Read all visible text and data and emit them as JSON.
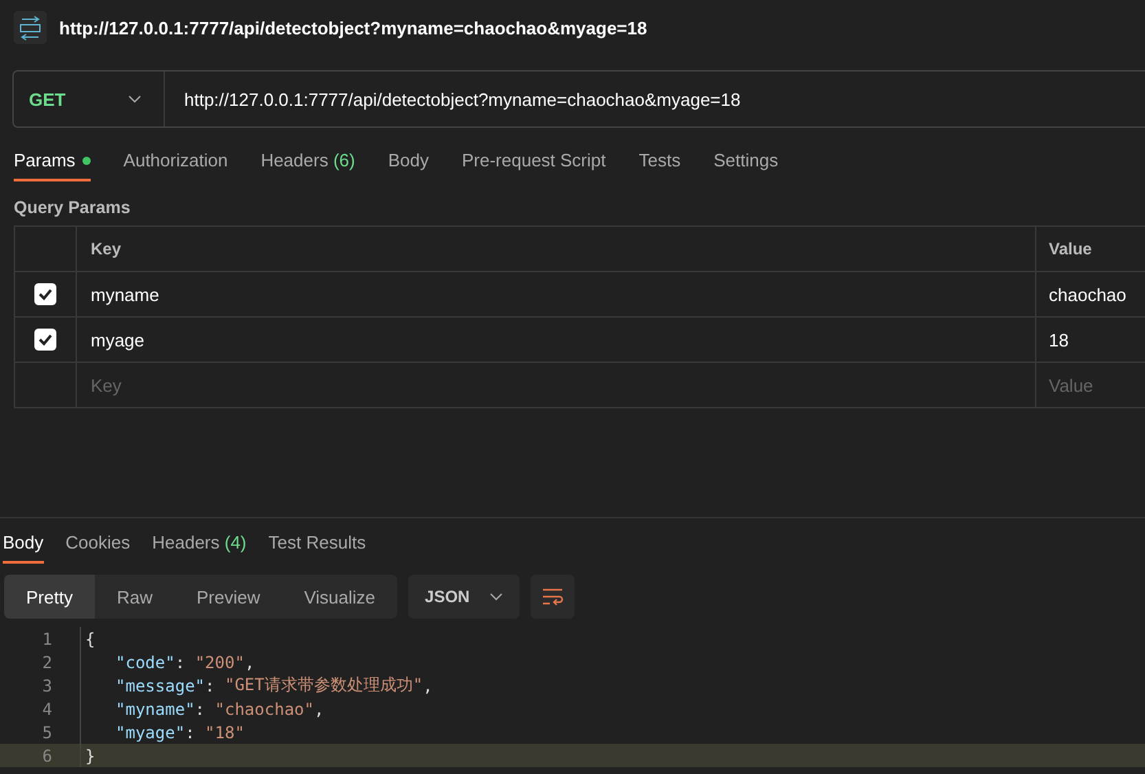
{
  "request_title": "http://127.0.0.1:7777/api/detectobject?myname=chaochao&myage=18",
  "method": "GET",
  "url": "http://127.0.0.1:7777/api/detectobject?myname=chaochao&myage=18",
  "request_tabs": [
    {
      "label": "Params",
      "dot": true,
      "selected": true
    },
    {
      "label": "Authorization",
      "dot": false,
      "selected": false
    },
    {
      "label": "Headers",
      "count": "(6)",
      "dot": false,
      "selected": false
    },
    {
      "label": "Body",
      "dot": false,
      "selected": false
    },
    {
      "label": "Pre-request Script",
      "dot": false,
      "selected": false
    },
    {
      "label": "Tests",
      "dot": false,
      "selected": false
    },
    {
      "label": "Settings",
      "dot": false,
      "selected": false
    }
  ],
  "query_params": {
    "title": "Query Params",
    "columns": [
      "Key",
      "Value"
    ],
    "rows": [
      {
        "checked": true,
        "key": "myname",
        "value": "chaochao"
      },
      {
        "checked": true,
        "key": "myage",
        "value": "18"
      }
    ],
    "new_row": {
      "key_placeholder": "Key",
      "value_placeholder": "Value"
    }
  },
  "response_tabs": [
    {
      "label": "Body",
      "selected": true
    },
    {
      "label": "Cookies",
      "selected": false
    },
    {
      "label": "Headers",
      "count": "(4)",
      "selected": false
    },
    {
      "label": "Test Results",
      "selected": false
    }
  ],
  "view_modes": [
    {
      "label": "Pretty",
      "selected": true
    },
    {
      "label": "Raw",
      "selected": false
    },
    {
      "label": "Preview",
      "selected": false
    },
    {
      "label": "Visualize",
      "selected": false
    }
  ],
  "format": "JSON",
  "code_lines": [
    {
      "number": "1",
      "highlighted": false,
      "tokens": [
        {
          "kind": "brace",
          "text": "{"
        }
      ]
    },
    {
      "number": "2",
      "highlighted": false,
      "tokens": [
        {
          "kind": "key",
          "text": "\"code\""
        },
        {
          "kind": "punct",
          "text": ": "
        },
        {
          "kind": "string",
          "text": "\"200\""
        },
        {
          "kind": "punct",
          "text": ","
        }
      ]
    },
    {
      "number": "3",
      "highlighted": false,
      "tokens": [
        {
          "kind": "key",
          "text": "\"message\""
        },
        {
          "kind": "punct",
          "text": ": "
        },
        {
          "kind": "string",
          "text": "\"GET请求带参数处理成功\""
        },
        {
          "kind": "punct",
          "text": ","
        }
      ]
    },
    {
      "number": "4",
      "highlighted": false,
      "tokens": [
        {
          "kind": "key",
          "text": "\"myname\""
        },
        {
          "kind": "punct",
          "text": ": "
        },
        {
          "kind": "string",
          "text": "\"chaochao\""
        },
        {
          "kind": "punct",
          "text": ","
        }
      ]
    },
    {
      "number": "5",
      "highlighted": false,
      "tokens": [
        {
          "kind": "key",
          "text": "\"myage\""
        },
        {
          "kind": "punct",
          "text": ": "
        },
        {
          "kind": "string",
          "text": "\"18\""
        }
      ]
    },
    {
      "number": "6",
      "highlighted": true,
      "tokens": [
        {
          "kind": "brace",
          "text": "}"
        }
      ]
    }
  ]
}
